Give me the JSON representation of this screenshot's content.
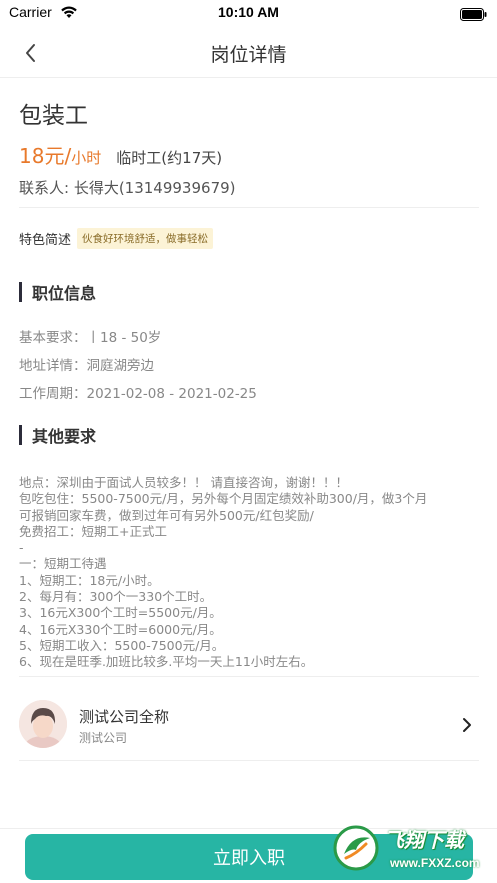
{
  "status_bar": {
    "carrier": "Carrier",
    "time": "10:10 AM"
  },
  "nav": {
    "title": "岗位详情",
    "back_icon": "chevron-left-icon"
  },
  "job": {
    "title": "包装工",
    "salary_amount": "18元/",
    "salary_unit": "小时",
    "type": "临时工(约17天)",
    "contact": "联系人: 长得大(13149939679)",
    "feature_label": "特色简述",
    "feature_tag": "伙食好环境舒适，做事轻松"
  },
  "position_info": {
    "title": "职位信息",
    "lines": [
      "基本要求：丨18 - 50岁",
      "地址详情：洞庭湖旁边",
      "工作周期：2021-02-08 - 2021-02-25"
    ]
  },
  "other_requirements": {
    "title": "其他要求",
    "lines": [
      "地点：深圳由于面试人员较多！！ 请直接咨询，谢谢！！！",
      "包吃包住：5500-7500元/月，另外每个月固定绩效补助300/月，做3个月",
      "可报销回家车费，做到过年可有另外500元/红包奖励/",
      "免费招工：短期工+正式工",
      "-",
      "一：短期工待遇",
      "1、短期工：18元/小时。",
      "2、每月有：300个一330个工时。",
      "3、16元X300个工时=5500元/月。",
      "4、16元X330个工时=6000元/月。",
      "5、短期工收入：5500-7500元/月。",
      "6、现在是旺季.加班比较多.平均一天上11小时左右。"
    ]
  },
  "company": {
    "name": "测试公司全称",
    "short_name": "测试公司",
    "avatar_icon": "avatar",
    "chevron_icon": "chevron-right-icon"
  },
  "bottom": {
    "join_label": "立即入职"
  },
  "watermark": {
    "main": "飞翔下载",
    "url": "www.FXXZ.com"
  },
  "colors": {
    "accent_orange": "#e8792b",
    "primary_teal": "#27b5a4",
    "tag_bg": "#fcf3d6"
  }
}
